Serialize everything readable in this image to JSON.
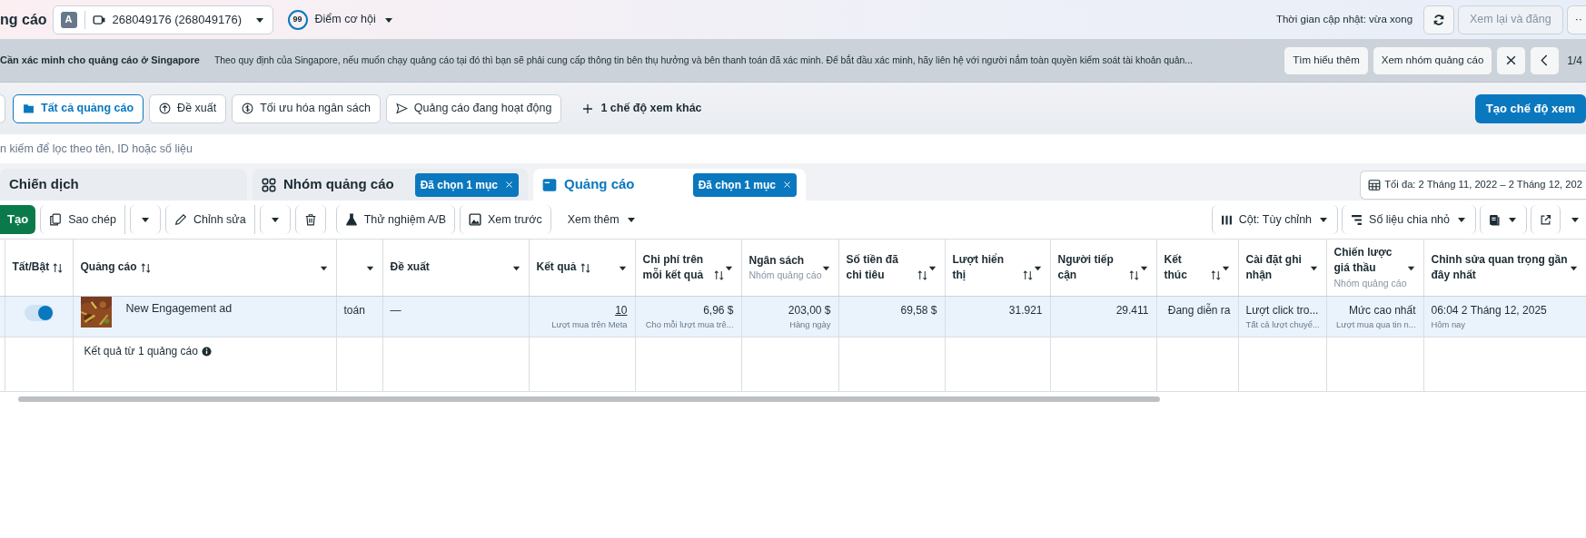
{
  "header": {
    "title": "ng cáo",
    "account_avatar": "A",
    "account": "268049176 (268049176)",
    "score": "99",
    "score_label": "Điểm cơ hội",
    "update_time": "Thời gian cập nhật: vừa xong",
    "review_button": "Xem lại và đăng",
    "more_button": "··"
  },
  "banner": {
    "title": "Cần xác minh cho quảng cáo ở Singapore",
    "text": "Theo quy định của Singapore, nếu muốn chạy quảng cáo tại đó thì bạn sẽ phải cung cấp thông tin bên thụ hưởng và bên thanh toán đã xác minh. Để bắt đầu xác minh, hãy liên hệ với người nắm toàn quyền kiểm soát tài khoản quản...",
    "buttons": [
      "Tìm hiểu thêm",
      "Xem nhóm quảng cáo"
    ],
    "pager": "1/4"
  },
  "views": [
    {
      "label": "Tất cả quảng cáo",
      "selected": true
    },
    {
      "label": "Đề xuất",
      "selected": false
    },
    {
      "label": "Tối ưu hóa ngân sách",
      "selected": false
    },
    {
      "label": "Quảng cáo đang hoạt động",
      "selected": false
    }
  ],
  "more_views": "1 chế độ xem khác",
  "create_view": "Tạo chế độ xem",
  "search": {
    "placeholder": "n kiếm để lọc theo tên, ID hoặc số liệu"
  },
  "level_tabs": [
    {
      "label": "Chiến dịch",
      "selected": false
    },
    {
      "label": "Nhóm quảng cáo",
      "selected": false,
      "badge": "Đã chọn 1 mục"
    },
    {
      "label": "Quảng cáo",
      "selected": true,
      "badge": "Đã chọn 1 mục"
    }
  ],
  "date_range": "Tối đa: 2 Tháng 11, 2022 – 2 Tháng 12, 202",
  "toolbar": {
    "create": "Tạo",
    "left": [
      {
        "label": "Sao chép",
        "split": true
      },
      {
        "label": "Chỉnh sửa",
        "split": true
      },
      {
        "split": false
      },
      {
        "label": "Thử nghiệm A/B",
        "split": false
      },
      {
        "label": "Xem trước",
        "split": false
      }
    ],
    "more": "Xem thêm",
    "right": [
      {
        "label": "Cột: Tùy chỉnh"
      },
      {
        "label": "Số liệu chia nhỏ"
      }
    ]
  },
  "table": {
    "columns": [
      {
        "label": "Tất/Bật",
        "sortable": true
      },
      {
        "label": "Quảng cáo",
        "sortable": true
      },
      {
        "sortable": false
      },
      {
        "label": "Đề xuất",
        "sortable": false
      },
      {
        "label": "Kết quả",
        "sortable": true
      },
      {
        "label": "Chi phí trên mỗi kết quả",
        "sortable": true
      },
      {
        "label": "Ngân sách",
        "sub": "Nhóm quảng cáo",
        "sortable": false
      },
      {
        "label": "Số tiền đã chi tiêu",
        "sortable": true
      },
      {
        "label": "Lượt hiển thị",
        "sortable": true
      },
      {
        "label": "Người tiếp cận",
        "sortable": true
      },
      {
        "label": "Kết thúc",
        "sortable": true
      },
      {
        "label": "Cài đặt ghi nhận",
        "sortable": false
      },
      {
        "label": "Chiến lược giá thầu",
        "sub": "Nhóm quảng cáo",
        "sortable": false
      },
      {
        "label": "Chỉnh sửa quan trọng gần đây nhất",
        "sortable": false
      }
    ],
    "rows": [
      {
        "on": true,
        "name": "New Engagement ad",
        "column_4": "toán",
        "recommendation": "—",
        "results": "10",
        "results_sub": "Lượt mua trên Meta",
        "cost": "6,96 $",
        "cost_sub": "Cho mỗi lượt mua trê...",
        "budget": "203,00 $",
        "budget_sub": "Hàng ngày",
        "spent": "69,58 $",
        "impressions": "31.921",
        "reach": "29.411",
        "end": "Đang diễn ra",
        "attribution": "Lượt click tro...",
        "attribution_sub": "Tất cả lượt chuyể...",
        "bid": "Mức cao nhất",
        "bid_sub": "Lượt mua qua tin n...",
        "edited": "06:04 2 Tháng 12, 2025",
        "edited_sub": "Hôm nay"
      }
    ],
    "summary": "Kết quả từ 1 quảng cáo"
  }
}
